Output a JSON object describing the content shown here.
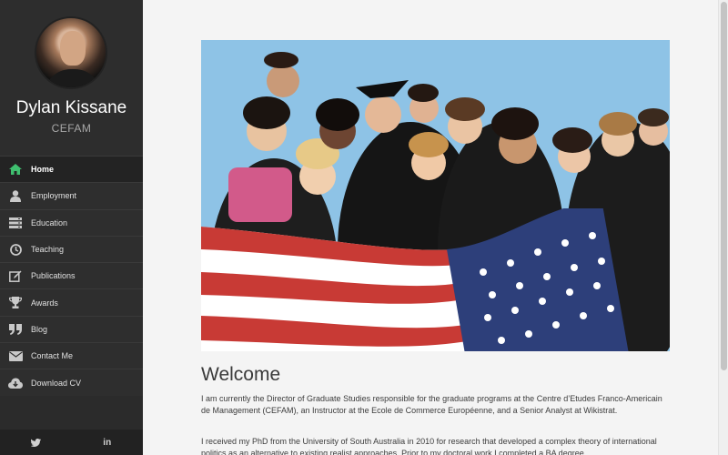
{
  "profile": {
    "name": "Dylan Kissane",
    "org": "CEFAM"
  },
  "nav": {
    "items": [
      {
        "label": "Home",
        "icon": "home-icon",
        "active": true
      },
      {
        "label": "Employment",
        "icon": "user-icon"
      },
      {
        "label": "Education",
        "icon": "server-icon"
      },
      {
        "label": "Teaching",
        "icon": "clock-icon"
      },
      {
        "label": "Publications",
        "icon": "edit-icon"
      },
      {
        "label": "Awards",
        "icon": "trophy-icon"
      },
      {
        "label": "Blog",
        "icon": "quote-icon"
      },
      {
        "label": "Contact Me",
        "icon": "envelope-icon"
      },
      {
        "label": "Download CV",
        "icon": "cloud-download-icon"
      }
    ],
    "active_color": "#3fbf6f"
  },
  "social": {
    "twitter": "twitter-icon",
    "linkedin_label": "in"
  },
  "main": {
    "title": "Welcome",
    "paragraph1": "I am currently the Director of Graduate Studies responsible for the graduate programs at the Centre d’Etudes Franco-Americain de Management (CEFAM), an Instructor at the Ecole de Commerce Européenne, and a Senior Analyst at Wikistrat.",
    "paragraph2": "I received my PhD from the University of South Australia in 2010 for research that developed a complex theory of international politics as an alternative to existing realist approaches. Prior to my doctoral work I completed a BA degree"
  }
}
